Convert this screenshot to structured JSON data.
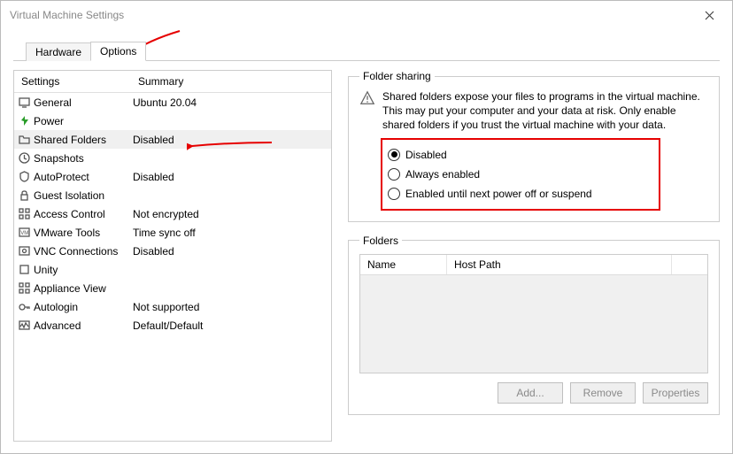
{
  "window": {
    "title": "Virtual Machine Settings"
  },
  "tabs": {
    "hardware": "Hardware",
    "options": "Options"
  },
  "list": {
    "header_settings": "Settings",
    "header_summary": "Summary",
    "rows": [
      {
        "icon": "monitor-icon",
        "label": "General",
        "summary": "Ubuntu 20.04"
      },
      {
        "icon": "power-icon",
        "label": "Power",
        "summary": ""
      },
      {
        "icon": "folder-icon",
        "label": "Shared Folders",
        "summary": "Disabled",
        "selected": true
      },
      {
        "icon": "clock-icon",
        "label": "Snapshots",
        "summary": ""
      },
      {
        "icon": "shield-icon",
        "label": "AutoProtect",
        "summary": "Disabled"
      },
      {
        "icon": "lock-icon",
        "label": "Guest Isolation",
        "summary": ""
      },
      {
        "icon": "grid-icon",
        "label": "Access Control",
        "summary": "Not encrypted"
      },
      {
        "icon": "vm-icon",
        "label": "VMware Tools",
        "summary": "Time sync off"
      },
      {
        "icon": "vnc-icon",
        "label": "VNC Connections",
        "summary": "Disabled"
      },
      {
        "icon": "square-icon",
        "label": "Unity",
        "summary": ""
      },
      {
        "icon": "apps-icon",
        "label": "Appliance View",
        "summary": ""
      },
      {
        "icon": "key-icon",
        "label": "Autologin",
        "summary": "Not supported"
      },
      {
        "icon": "wave-icon",
        "label": "Advanced",
        "summary": "Default/Default"
      }
    ]
  },
  "folder_sharing": {
    "legend": "Folder sharing",
    "warning": "Shared folders expose your files to programs in the virtual machine. This may put your computer and your data at risk. Only enable shared folders if you trust the virtual machine with your data.",
    "options": {
      "disabled": "Disabled",
      "always": "Always enabled",
      "until": "Enabled until next power off or suspend"
    },
    "selected": "disabled"
  },
  "folders": {
    "legend": "Folders",
    "col_name": "Name",
    "col_host": "Host Path",
    "buttons": {
      "add": "Add...",
      "remove": "Remove",
      "properties": "Properties"
    }
  }
}
